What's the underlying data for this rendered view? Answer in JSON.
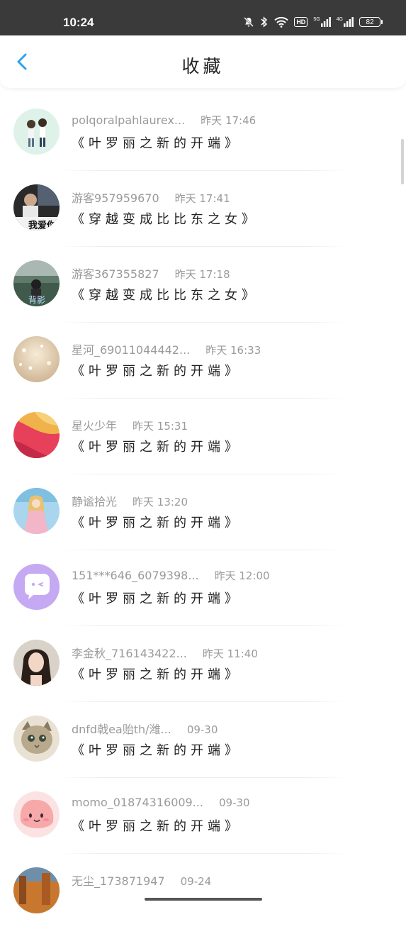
{
  "status_bar": {
    "time": "10:24",
    "hd_label": "HD",
    "signal1_label": "5G",
    "signal2_label": "4G",
    "battery": "82"
  },
  "nav": {
    "title": "收藏",
    "back_icon": "chevron-left-icon",
    "accent_color": "#2ba3f0"
  },
  "items": [
    {
      "user": "polqoralpahlaurex...",
      "time": "昨天 17:46",
      "book": "《叶罗丽之新的开端》",
      "avatar": "couple-illustration"
    },
    {
      "user": "游客957959670",
      "time": "昨天 17:41",
      "book": "《穿越变成比比东之女》",
      "avatar": "photo-我爱你",
      "avatar_text": "我爱你"
    },
    {
      "user": "游客367355827",
      "time": "昨天 17:18",
      "book": "《穿越变成比比东之女》",
      "avatar": "photo-背影",
      "avatar_text": "背影"
    },
    {
      "user": "星河_69011044442...",
      "time": "昨天 16:33",
      "book": "《叶罗丽之新的开端》",
      "avatar": "glitter-photo"
    },
    {
      "user": "星火少年",
      "time": "昨天 15:31",
      "book": "《叶罗丽之新的开端》",
      "avatar": "flower-photo"
    },
    {
      "user": "静谧拾光",
      "time": "昨天 13:20",
      "book": "《叶罗丽之新的开端》",
      "avatar": "anime-girl"
    },
    {
      "user": "151***646_6079398...",
      "time": "昨天 12:00",
      "book": "《叶罗丽之新的开端》",
      "avatar": "chat-bubble-icon"
    },
    {
      "user": "李金秋_716143422...",
      "time": "昨天 11:40",
      "book": "《叶罗丽之新的开端》",
      "avatar": "portrait-photo"
    },
    {
      "user": "dnfd戟ea贻th/潍...",
      "time": "09-30",
      "book": "《叶罗丽之新的开端》",
      "avatar": "kitten-photo"
    },
    {
      "user": "momo_01874316009...",
      "time": "09-30",
      "book": "《叶罗丽之新的开端》",
      "avatar": "pink-blob-illustration"
    },
    {
      "user": "无尘_173871947",
      "time": "09-24",
      "book": "",
      "avatar": "autumn-photo"
    }
  ]
}
